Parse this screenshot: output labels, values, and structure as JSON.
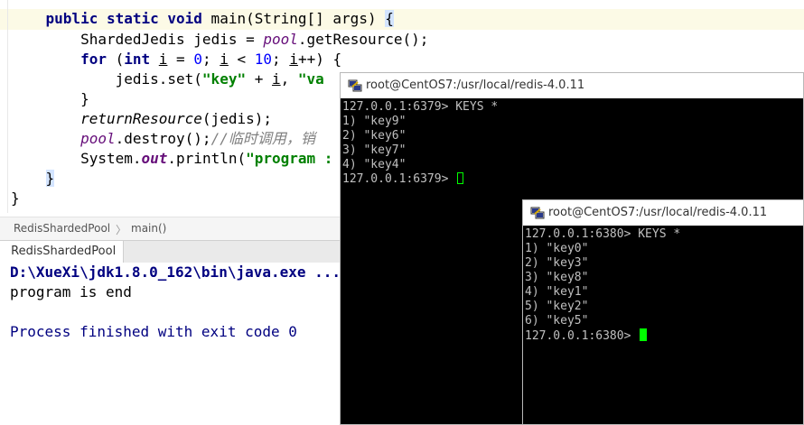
{
  "editor": {
    "line1": {
      "kw": "public static void",
      "rest": " main(String[] args) ",
      "brace": "{"
    },
    "line2": {
      "type": "ShardedJedis ",
      "var": "jedis",
      "eq": " = ",
      "pool": "pool",
      "call": ".getResource();"
    },
    "line3": {
      "for": "for",
      "open": " (",
      "int": "int",
      "i1": "i",
      "a": " = ",
      "zero": "0",
      "b": "; ",
      "i2": "i",
      "c": " < ",
      "ten": "10",
      "d": "; ",
      "i3": "i",
      "e": "++) {"
    },
    "line4": {
      "pre": "jedis.set(",
      "key": "\"key\"",
      "plus": " + ",
      "iv": "i",
      "comma": ", ",
      "val": "\"va"
    },
    "line5": {
      "text": "}"
    },
    "line6": {
      "fn": "returnResource",
      "args": "(jedis);"
    },
    "line7": {
      "pool": "pool",
      "call": ".destroy();",
      "comment": "//临时调用，销"
    },
    "line8": {
      "sys": "System.",
      "out": "out",
      "call": ".println(",
      "str": "\"program :"
    },
    "line9": {
      "text": "}"
    },
    "line10": {
      "text": "}"
    }
  },
  "breadcrumb": {
    "class_name": "RedisShardedPool",
    "sep": "〉",
    "method": "main()"
  },
  "run_panel": {
    "tab_label": "RedisShardedPool",
    "lines": {
      "cmd": "D:\\XueXi\\jdk1.8.0_162\\bin\\java.exe ...",
      "out": "program is end",
      "exit": "Process finished with exit code 0"
    }
  },
  "putty1": {
    "title": "root@CentOS7:/usr/local/redis-4.0.11",
    "lines": [
      "127.0.0.1:6379> KEYS *",
      "1) \"key9\"",
      "2) \"key6\"",
      "3) \"key7\"",
      "4) \"key4\""
    ],
    "prompt": "127.0.0.1:6379> "
  },
  "putty2": {
    "title": "root@CentOS7:/usr/local/redis-4.0.11",
    "lines": [
      "127.0.0.1:6380> KEYS *",
      "1) \"key0\"",
      "2) \"key3\"",
      "3) \"key8\"",
      "4) \"key1\"",
      "5) \"key2\"",
      "6) \"key5\""
    ],
    "prompt": "127.0.0.1:6380> "
  },
  "colors": {
    "keyword": "#000080",
    "string": "#008000",
    "number": "#0000ff",
    "field": "#660e7a",
    "console_cmd": "#000080",
    "terminal_cursor": "#00ff00"
  }
}
